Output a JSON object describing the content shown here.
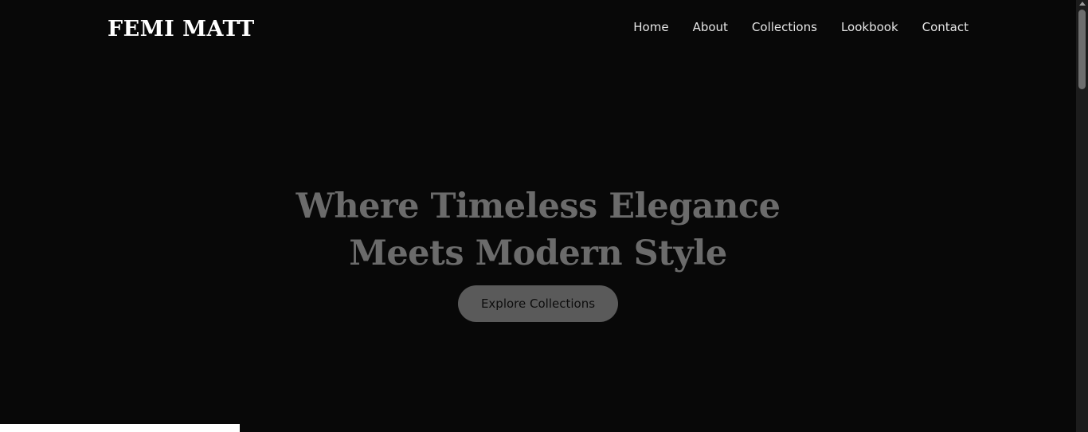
{
  "brand": {
    "name": "FEMI MATT"
  },
  "nav": {
    "items": [
      {
        "label": "Home"
      },
      {
        "label": "About"
      },
      {
        "label": "Collections"
      },
      {
        "label": "Lookbook"
      },
      {
        "label": "Contact"
      }
    ]
  },
  "hero": {
    "title": "Where Timeless Elegance Meets Modern Style",
    "cta_label": "Explore Collections"
  },
  "colors": {
    "background": "#080808",
    "logo": "#ffffff",
    "nav_text": "#e6e6e6",
    "hero_title": "#6b6b6b",
    "cta_bg": "#5a5a5a",
    "cta_text": "#0d0d0d"
  },
  "icons": {
    "scroll_up": "chevron-up-icon"
  }
}
